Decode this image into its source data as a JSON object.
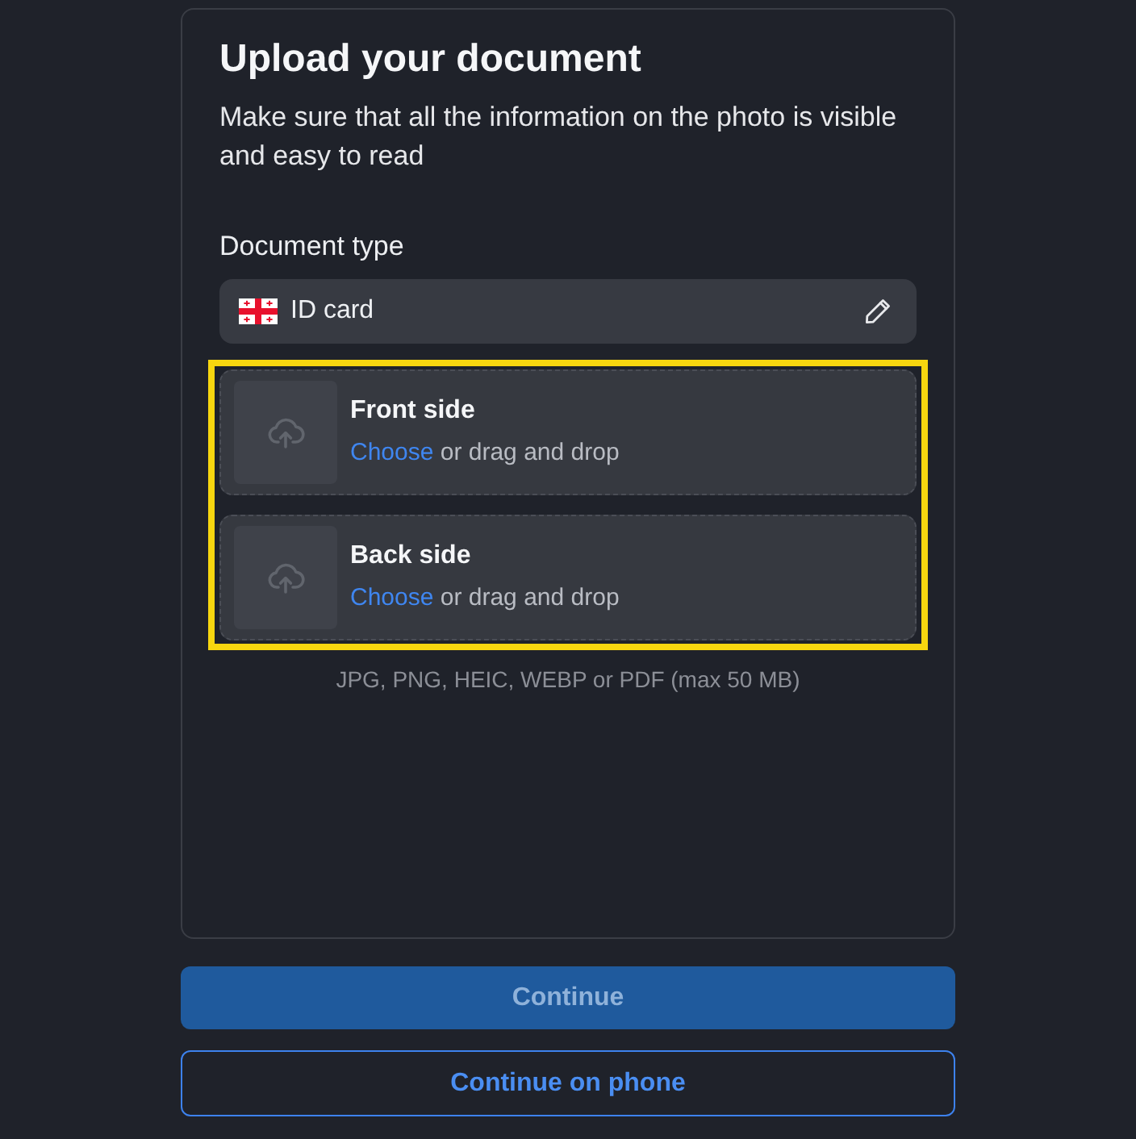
{
  "title": "Upload your document",
  "description": "Make sure that all the information on the photo is visible and easy to read",
  "document_type": {
    "label": "Document type",
    "value": "ID card"
  },
  "upload_area": {
    "highlighted": true,
    "slots": [
      {
        "title": "Front side",
        "link": "Choose",
        "hint": "or drag and drop"
      },
      {
        "title": "Back side",
        "link": "Choose",
        "hint": "or drag and drop"
      }
    ]
  },
  "formats_note": "JPG, PNG, HEIC, WEBP or PDF (max 50 MB)",
  "buttons": [
    {
      "label": "Continue",
      "kind": "primary",
      "disabled": true
    },
    {
      "label": "Continue on phone",
      "kind": "outline",
      "disabled": false
    }
  ]
}
